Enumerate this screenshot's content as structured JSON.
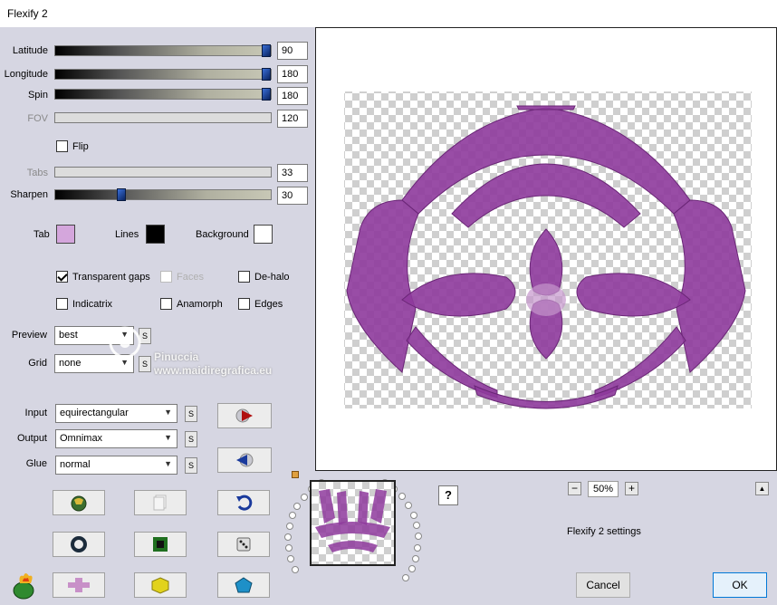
{
  "window": {
    "title": "Flexify 2"
  },
  "sliders": {
    "latitude": {
      "label": "Latitude",
      "value": "90"
    },
    "longitude": {
      "label": "Longitude",
      "value": "180"
    },
    "spin": {
      "label": "Spin",
      "value": "180"
    },
    "fov": {
      "label": "FOV",
      "value": "120"
    },
    "tabs": {
      "label": "Tabs",
      "value": "33"
    },
    "sharpen": {
      "label": "Sharpen",
      "value": "30"
    }
  },
  "flip": {
    "label": "Flip",
    "checked": false
  },
  "colors": {
    "tab": {
      "label": "Tab",
      "color": "#d4a6dc"
    },
    "lines": {
      "label": "Lines",
      "color": "#000000"
    },
    "background": {
      "label": "Background",
      "color": "#ffffff"
    }
  },
  "options": {
    "transparent_gaps": {
      "label": "Transparent gaps",
      "checked": true
    },
    "faces": {
      "label": "Faces",
      "checked": false,
      "disabled": true
    },
    "de_halo": {
      "label": "De-halo",
      "checked": false
    },
    "indicatrix": {
      "label": "Indicatrix",
      "checked": false
    },
    "anamorph": {
      "label": "Anamorph",
      "checked": false
    },
    "edges": {
      "label": "Edges",
      "checked": false
    }
  },
  "preview": {
    "label": "Preview",
    "value": "best"
  },
  "grid": {
    "label": "Grid",
    "value": "none"
  },
  "input": {
    "label": "Input",
    "value": "equirectangular"
  },
  "output": {
    "label": "Output",
    "value": "Omnimax"
  },
  "glue": {
    "label": "Glue",
    "value": "normal"
  },
  "s_button": "S",
  "watermark": {
    "line1": "Pinuccia",
    "line2": "www.maidiregrafica.eu"
  },
  "zoom": {
    "minus": "−",
    "value": "50%",
    "plus": "+"
  },
  "help": "?",
  "settings_name": "Flexify 2 settings",
  "buttons": {
    "cancel": "Cancel",
    "ok": "OK"
  },
  "accent": "#8e3a9c"
}
